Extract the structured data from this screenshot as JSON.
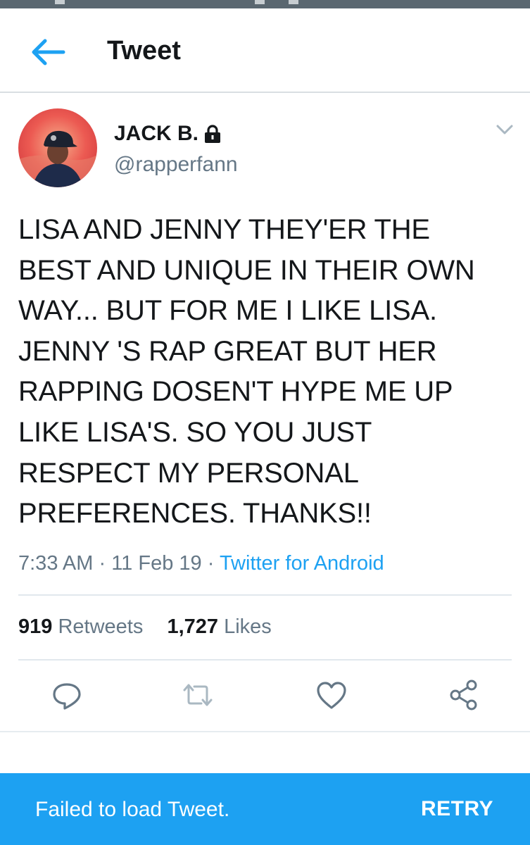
{
  "header": {
    "title": "Tweet",
    "back_icon": "arrow-left-icon"
  },
  "tweet": {
    "author_name": "JACK B.",
    "handle": "@rapperfann",
    "protected_icon": "lock-icon",
    "text": "LISA AND JENNY THEY'ER THE\nBEST AND UNIQUE IN THEIR OWN\nWAY... BUT FOR ME I LIKE LISA.\nJENNY 'S RAP GREAT  BUT HER\nRAPPING DOSEN'T HYPE ME UP\nLIKE LISA'S. SO YOU JUST\nRESPECT MY PERSONAL\nPREFERENCES. THANKS!!",
    "time": "7:33 AM",
    "separator": "·",
    "date": "11 Feb 19",
    "client": "Twitter for Android",
    "retweet_count": "919",
    "retweet_label": "Retweets",
    "like_count": "1,727",
    "like_label": "Likes"
  },
  "actions": [
    "reply-icon",
    "retweet-icon",
    "like-icon",
    "share-icon"
  ],
  "snackbar": {
    "message": "Failed to load Tweet.",
    "action": "RETRY"
  },
  "colors": {
    "accent": "#1da1f2",
    "secondary_text": "#657786",
    "text": "#14171a"
  }
}
